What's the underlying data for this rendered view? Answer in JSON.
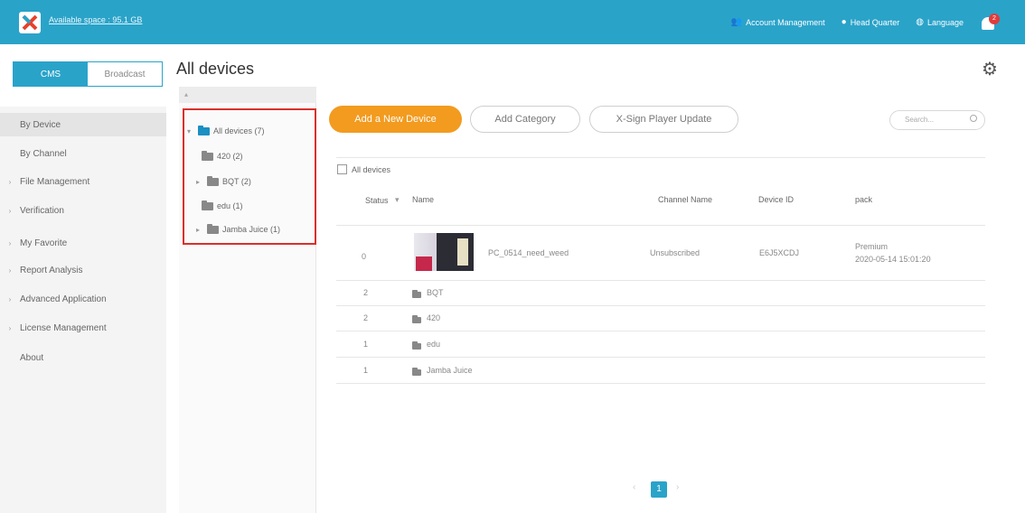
{
  "header": {
    "space_text": "Available space : 95.1 GB",
    "account": "Account Management",
    "hq": "Head Quarter",
    "language": "Language",
    "notification_count": "2"
  },
  "page": {
    "title": "All devices"
  },
  "tabs": [
    {
      "label": "CMS"
    },
    {
      "label": "Broadcast"
    }
  ],
  "nav": {
    "items": [
      {
        "label": "By Device"
      },
      {
        "label": "By Channel"
      },
      {
        "label": "File Management"
      },
      {
        "label": "Verification"
      },
      {
        "label": "My Favorite"
      },
      {
        "label": "Report Analysis"
      },
      {
        "label": "Advanced Application"
      },
      {
        "label": "License Management"
      },
      {
        "label": "About"
      }
    ]
  },
  "tree": {
    "root": "All devices (7)",
    "children": [
      {
        "label": "420 (2)"
      },
      {
        "label": "BQT (2)"
      },
      {
        "label": "edu (1)"
      },
      {
        "label": "Jamba Juice (1)"
      }
    ]
  },
  "toolbar": {
    "add_device": "Add a New Device",
    "add_category": "Add Category",
    "player_update": "X-Sign Player Update",
    "search_placeholder": "Search..."
  },
  "table": {
    "select_all": "All devices",
    "headers": {
      "status": "Status",
      "name": "Name",
      "channel": "Channel Name",
      "device_id": "Device ID",
      "pack": "pack"
    },
    "device": {
      "status": "0",
      "name": "PC_0514_need_weed",
      "channel": "Unsubscribed",
      "device_id": "E6J5XCDJ",
      "pack": "Premium",
      "pack_date": "2020-05-14 15:01:20"
    },
    "groups": [
      {
        "count": "2",
        "name": "BQT"
      },
      {
        "count": "2",
        "name": "420"
      },
      {
        "count": "1",
        "name": "edu"
      },
      {
        "count": "1",
        "name": "Jamba Juice"
      }
    ]
  },
  "pagination": {
    "current": "1"
  }
}
